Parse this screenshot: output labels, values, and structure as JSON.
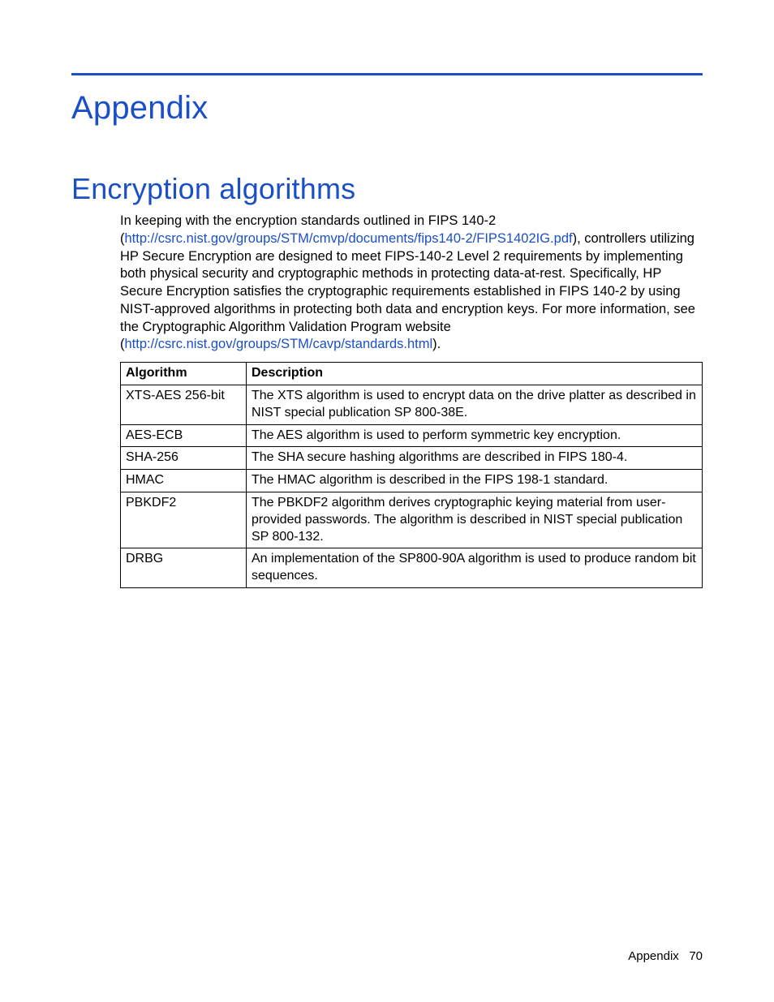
{
  "headings": {
    "title": "Appendix",
    "section": "Encryption algorithms"
  },
  "intro": {
    "p1a": "In keeping with the encryption standards outlined in FIPS 140-2 (",
    "link1": "http://csrc.nist.gov/groups/STM/cmvp/documents/fips140-2/FIPS1402IG.pdf",
    "p1b": "), controllers utilizing HP Secure Encryption are designed to meet FIPS-140-2 Level 2 requirements by implementing both physical security and cryptographic methods in protecting data-at-rest. Specifically, HP Secure Encryption satisfies the cryptographic requirements established in FIPS 140-2 by using NIST-approved algorithms in protecting both data and encryption keys. For more information, see the Cryptographic Algorithm Validation Program website (",
    "link2": "http://csrc.nist.gov/groups/STM/cavp/standards.html",
    "p1c": ")."
  },
  "table": {
    "headers": {
      "col1": "Algorithm",
      "col2": "Description"
    },
    "rows": [
      {
        "algo": "XTS-AES 256-bit",
        "desc": "The XTS algorithm is used to encrypt data on the drive platter as described in NIST special publication SP 800-38E."
      },
      {
        "algo": "AES-ECB",
        "desc": "The AES algorithm is used to perform symmetric key encryption."
      },
      {
        "algo": "SHA-256",
        "desc": "The SHA secure hashing algorithms are described in FIPS 180-4."
      },
      {
        "algo": "HMAC",
        "desc": "The HMAC algorithm is described in the FIPS 198-1 standard."
      },
      {
        "algo": "PBKDF2",
        "desc": "The PBKDF2 algorithm derives cryptographic keying material from user-provided passwords. The algorithm is described in NIST special publication SP 800-132."
      },
      {
        "algo": "DRBG",
        "desc": "An implementation of the SP800-90A algorithm is used to produce random bit sequences."
      }
    ]
  },
  "footer": {
    "label": "Appendix",
    "page": "70"
  }
}
